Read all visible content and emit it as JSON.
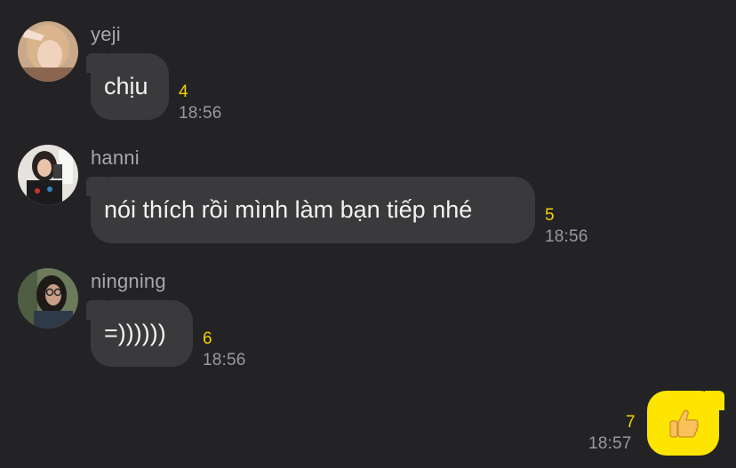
{
  "messages": [
    {
      "sender": "yeji",
      "text": "chịu",
      "unread": "4",
      "time": "18:56"
    },
    {
      "sender": "hanni",
      "text": "nói thích rồi mình làm bạn tiếp nhé",
      "unread": "5",
      "time": "18:56"
    },
    {
      "sender": "ningning",
      "text": "=))))))",
      "unread": "6",
      "time": "18:56"
    }
  ],
  "my_message": {
    "emoji": "thumbs-up-emoji",
    "unread": "7",
    "time": "18:57"
  },
  "colors": {
    "background": "#232325",
    "bubble": "#3a3a3c",
    "my_bubble": "#fee500",
    "unread": "#f6d000"
  }
}
